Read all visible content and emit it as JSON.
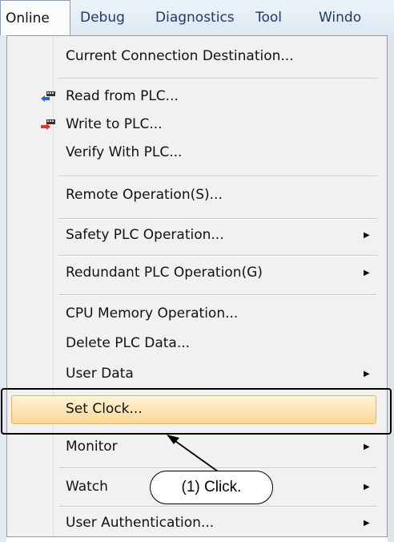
{
  "menubar": {
    "items": [
      "Online",
      "Debug",
      "Diagnostics",
      "Tool",
      "Windo"
    ]
  },
  "menu": {
    "items": [
      {
        "label": "Current Connection Destination...",
        "submenu": false
      },
      {
        "label": "Read from PLC...",
        "submenu": false,
        "icon": "read-from-plc-icon"
      },
      {
        "label": "Write to PLC...",
        "submenu": false,
        "icon": "write-to-plc-icon"
      },
      {
        "label": "Verify With PLC...",
        "submenu": false
      },
      {
        "label": "Remote Operation(S)...",
        "submenu": false
      },
      {
        "label": "Safety PLC Operation...",
        "submenu": true
      },
      {
        "label": "Redundant PLC Operation(G)",
        "submenu": true
      },
      {
        "label": "CPU Memory Operation...",
        "submenu": false
      },
      {
        "label": "Delete PLC Data...",
        "submenu": false
      },
      {
        "label": "User Data",
        "submenu": true
      },
      {
        "label": "Set Clock...",
        "submenu": false,
        "highlighted": true
      },
      {
        "label": "Monitor",
        "submenu": true
      },
      {
        "label": "Watch",
        "submenu": true
      },
      {
        "label": "User Authentication...",
        "submenu": true
      }
    ]
  },
  "callout": {
    "text": "(1) Click."
  },
  "colors": {
    "highlight": "#fbd896",
    "highlight_border": "#e6b45a",
    "menubar": "#dde6f2"
  }
}
